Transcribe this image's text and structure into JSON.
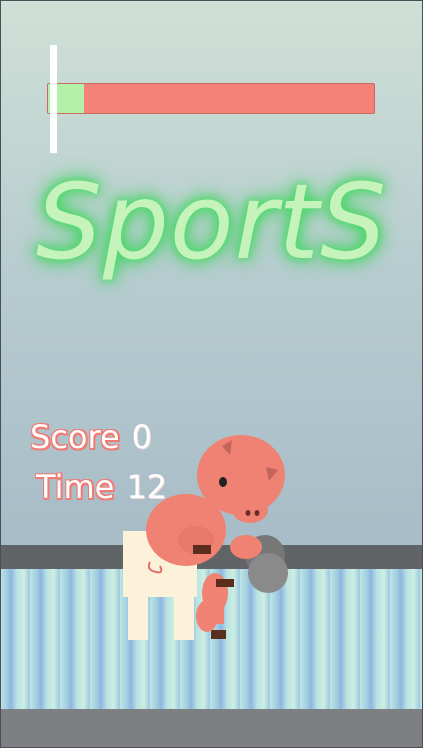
{
  "title": "SportS",
  "hud": {
    "score_label": "Score",
    "score_value": "0",
    "time_label": "Time",
    "time_value": "12"
  },
  "power_meter": {
    "fill_fraction": 0.11
  },
  "colors": {
    "title_glow": "#3cd35c",
    "bar_bg": "#f58276",
    "bar_fill": "#b3f0a8",
    "pig": "#ef8272",
    "label_accent": "#f17a72"
  },
  "icons": {
    "character": "pig-lifting-dumbbell-icon",
    "bench": "bench-icon"
  }
}
